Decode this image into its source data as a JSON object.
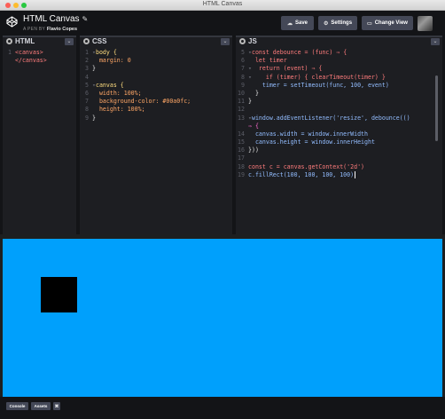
{
  "window": {
    "title": "HTML Canvas"
  },
  "header": {
    "pen_title": "HTML Canvas",
    "author_prefix": "A PEN BY",
    "author_name": "Flavio Copes",
    "buttons": {
      "save": "Save",
      "settings": "Settings",
      "change_view": "Change View"
    },
    "icons": {
      "save": "cloud-icon",
      "settings": "gear-icon",
      "change_view": "layout-icon",
      "edit_title": "pencil-icon"
    }
  },
  "editors": {
    "html": {
      "label": "HTML",
      "lines": [
        {
          "n": "1",
          "text": "<canvas>"
        },
        {
          "n": "",
          "text": "</canvas>"
        }
      ]
    },
    "css": {
      "label": "CSS",
      "lines": [
        {
          "n": "1",
          "fold": "▾",
          "text": "body {"
        },
        {
          "n": "2",
          "text": "  margin: 0"
        },
        {
          "n": "3",
          "text": "}"
        },
        {
          "n": "4",
          "text": ""
        },
        {
          "n": "5",
          "fold": "▾",
          "text": "canvas {"
        },
        {
          "n": "6",
          "text": "  width: 100%;"
        },
        {
          "n": "7",
          "text": "  background-color: #00a0fc;"
        },
        {
          "n": "8",
          "text": "  height: 100%;"
        },
        {
          "n": "9",
          "text": "}"
        }
      ]
    },
    "js": {
      "label": "JS",
      "lines": [
        {
          "n": "5",
          "fold": "▾",
          "text": "const debounce = (func) ⇒ {"
        },
        {
          "n": "6",
          "text": "  let timer"
        },
        {
          "n": "7",
          "fold": "▾",
          "text": "  return (event) ⇒ {"
        },
        {
          "n": "8",
          "fold": "▾",
          "text": "    if (timer) { clearTimeout(timer) }"
        },
        {
          "n": "9",
          "text": "    timer = setTimeout(func, 100, event)"
        },
        {
          "n": "10",
          "text": "  }"
        },
        {
          "n": "11",
          "text": "}"
        },
        {
          "n": "12",
          "text": ""
        },
        {
          "n": "13",
          "fold": "▾",
          "text": "window.addEventListener('resize', debounce(()"
        },
        {
          "n": "",
          "text": "⇒ {"
        },
        {
          "n": "14",
          "text": "  canvas.width = window.innerWidth"
        },
        {
          "n": "15",
          "text": "  canvas.height = window.innerHeight"
        },
        {
          "n": "16",
          "text": "}))"
        },
        {
          "n": "17",
          "text": ""
        },
        {
          "n": "18",
          "text": "const c = canvas.getContext('2d')"
        },
        {
          "n": "19",
          "text": "c.fillRect(100, 100, 100, 100)"
        }
      ]
    }
  },
  "preview": {
    "background_color": "#00a0fc",
    "rect_color": "#000000"
  },
  "footer": {
    "console": "Console",
    "assets": "Assets",
    "shortcuts": "⌘"
  },
  "colors": {
    "accent_bg": "#131417",
    "editor_bg": "#1d1e22",
    "button_bg": "#444857"
  }
}
